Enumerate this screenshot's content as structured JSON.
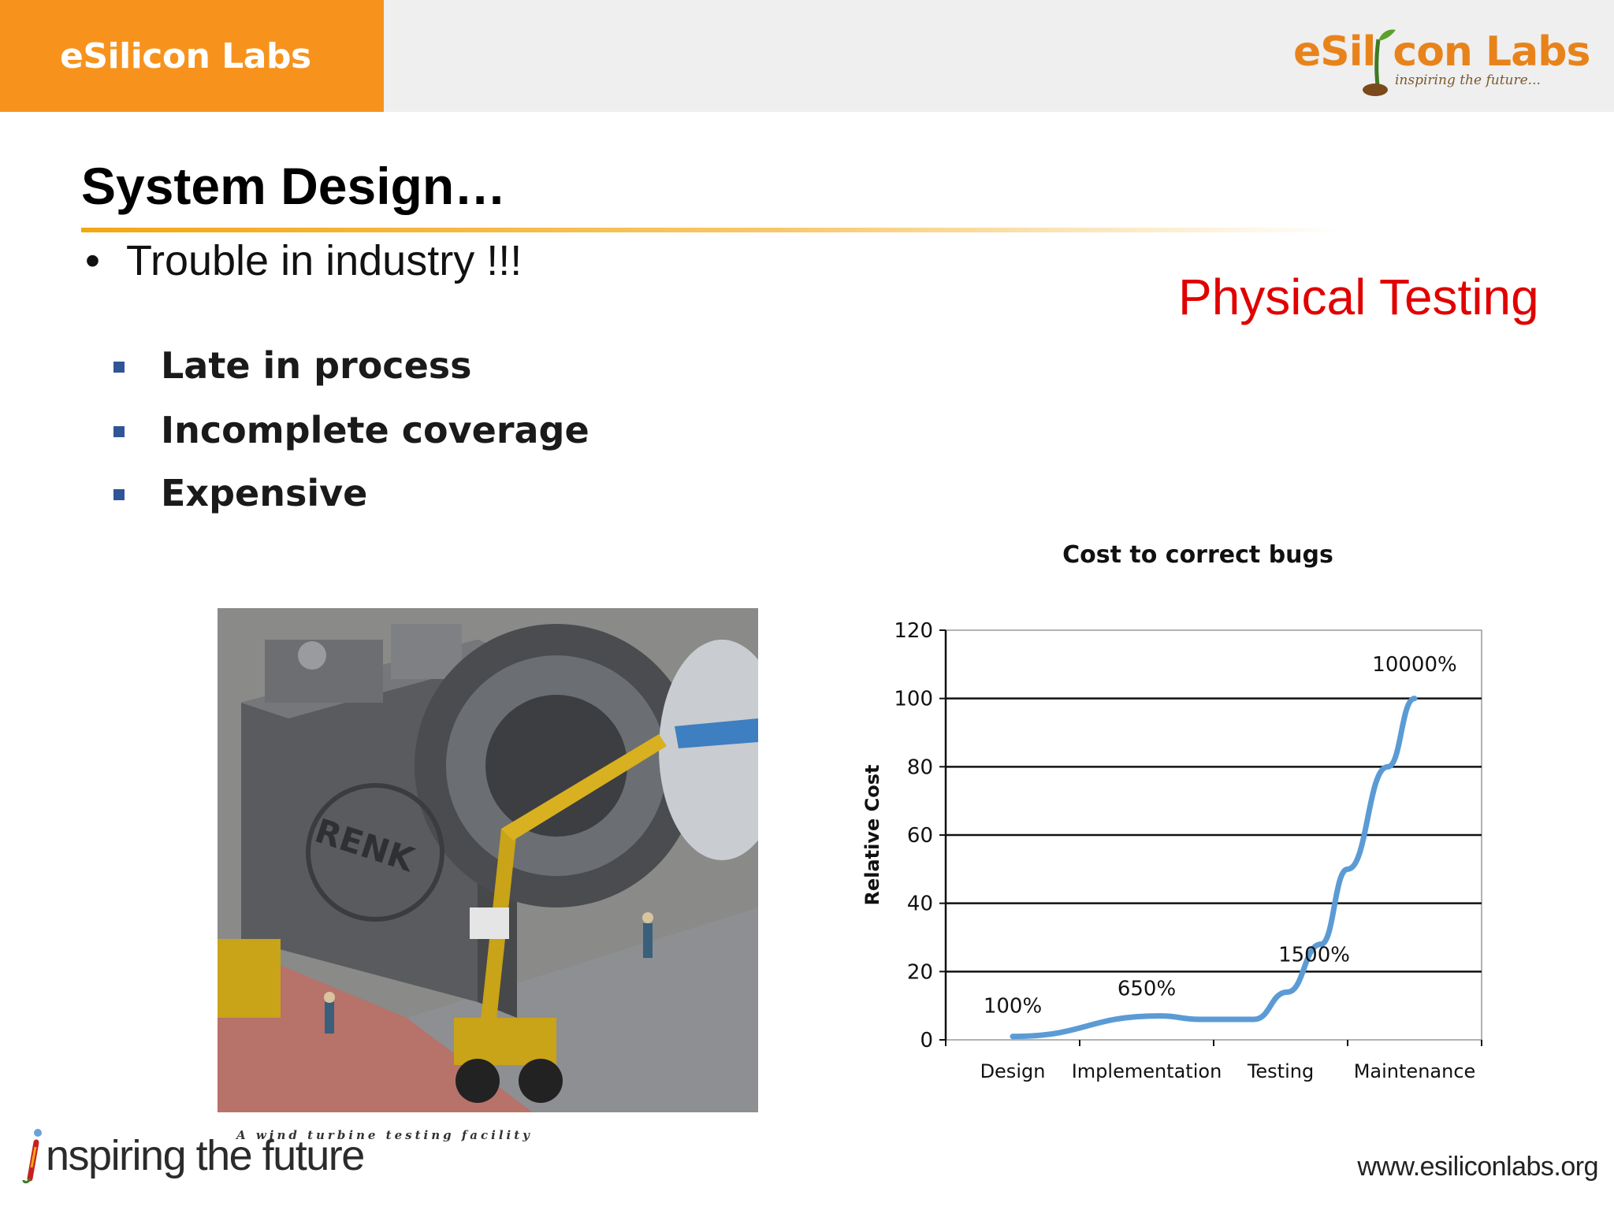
{
  "header": {
    "brand": "eSilicon Labs",
    "logo_text_a": "eSil",
    "logo_text_b": "con Labs",
    "logo_tagline": "inspiring the future..."
  },
  "slide": {
    "title": "System Design…",
    "bullet": "Trouble in industry !!!",
    "highlight": "Physical Testing",
    "sub_bullets": [
      "Late in process",
      "Incomplete coverage",
      "Expensive"
    ],
    "photo_caption": "A wind turbine testing facility",
    "photo_sign": "RENK"
  },
  "footer": {
    "tagline": "nspiring the future",
    "url": "www.esiliconlabs.org"
  },
  "colors": {
    "header_orange": "#f7931d",
    "highlight_red": "#e00000",
    "line_blue": "#5b9bd5",
    "bullet_blue": "#2f5597"
  },
  "chart_data": {
    "type": "line",
    "title": "Cost to correct bugs",
    "ylabel": "Relative Cost",
    "xlabel": "",
    "categories": [
      "Design",
      "Implementation",
      "Testing",
      "Maintenance"
    ],
    "ylim": [
      0,
      120
    ],
    "yticks": [
      0,
      20,
      40,
      60,
      80,
      100,
      120
    ],
    "grid": true,
    "series": [
      {
        "x": [
          0.5,
          1.6,
          1.9,
          2.3,
          2.55,
          2.8,
          3.0,
          3.3,
          3.5
        ],
        "values": [
          1,
          7,
          6,
          6,
          14,
          28,
          50,
          80,
          100
        ]
      }
    ],
    "annotations": [
      {
        "text": "100%",
        "x": 0.5,
        "y": 8
      },
      {
        "text": "650%",
        "x": 1.5,
        "y": 13
      },
      {
        "text": "1500%",
        "x": 2.75,
        "y": 23
      },
      {
        "text": "10000%",
        "x": 3.5,
        "y": 108
      }
    ]
  }
}
